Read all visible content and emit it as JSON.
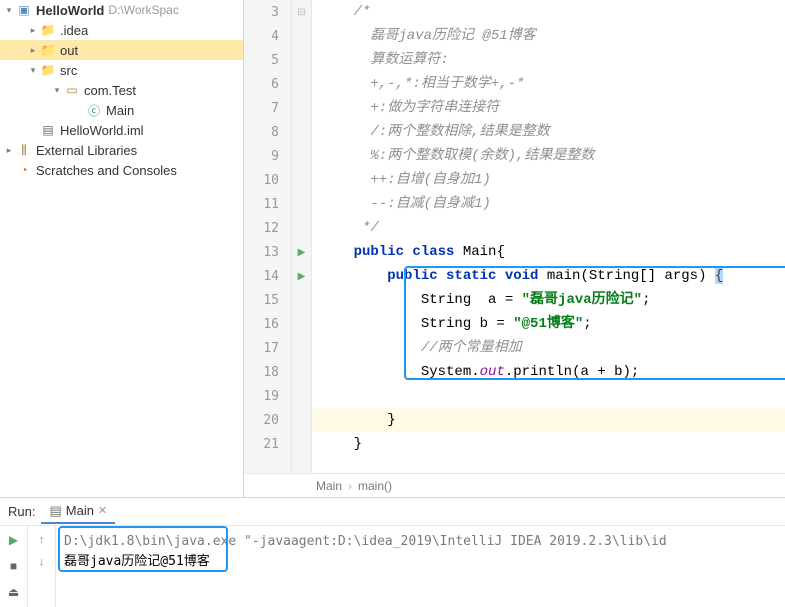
{
  "project": {
    "root": {
      "label": "HelloWorld",
      "path": "D:\\WorkSpac"
    },
    "idea": {
      "label": ".idea"
    },
    "out": {
      "label": "out"
    },
    "src": {
      "label": "src"
    },
    "pkg": {
      "label": "com.Test"
    },
    "main_class": {
      "label": "Main"
    },
    "iml": {
      "label": "HelloWorld.iml"
    },
    "libs": {
      "label": "External Libraries"
    },
    "scratches": {
      "label": "Scratches and Consoles"
    }
  },
  "code": {
    "l3": "    /*",
    "l4": "      磊哥java历险记 @51博客",
    "l5": "      算数运算符:",
    "l6": "      +,-,*:相当于数学+,-*",
    "l7": "      +:做为字符串连接符",
    "l8": "      /:两个整数相除,结果是整数",
    "l9": "      %:两个整数取模(余数),结果是整数",
    "l10": "      ++:自增(自身加1)",
    "l11": "      --:自减(自身减1)",
    "l12": "     */",
    "l13_kw": "public class",
    "l13_name": " Main{",
    "l14_pre": "        ",
    "l14_kw": "public static void",
    "l14_rest": " main(String[] args) ",
    "l14_brace": "{",
    "l15_pre": "            String  a = ",
    "l15_str": "\"磊哥java历险记\"",
    "l15_end": ";",
    "l16_pre": "            String b = ",
    "l16_str": "\"@51博客\"",
    "l16_end": ";",
    "l17": "            //两个常量相加",
    "l18_pre": "            System.",
    "l18_out": "out",
    "l18_rest": ".println(a + b);",
    "l19": "",
    "l20": "        }",
    "l21": "    }"
  },
  "gutter": {
    "n3": "3",
    "n4": "4",
    "n5": "5",
    "n6": "6",
    "n7": "7",
    "n8": "8",
    "n9": "9",
    "n10": "10",
    "n11": "11",
    "n12": "12",
    "n13": "13",
    "n14": "14",
    "n15": "15",
    "n16": "16",
    "n17": "17",
    "n18": "18",
    "n19": "19",
    "n20": "20",
    "n21": "21"
  },
  "breadcrumb": {
    "a": "Main",
    "b": "main()"
  },
  "run": {
    "label": "Run:",
    "tab": "Main",
    "cmd": "D:\\jdk1.8\\bin\\java.exe \"-javaagent:D:\\idea_2019\\IntelliJ IDEA 2019.2.3\\lib\\id",
    "output": "磊哥java历险记@51博客"
  }
}
